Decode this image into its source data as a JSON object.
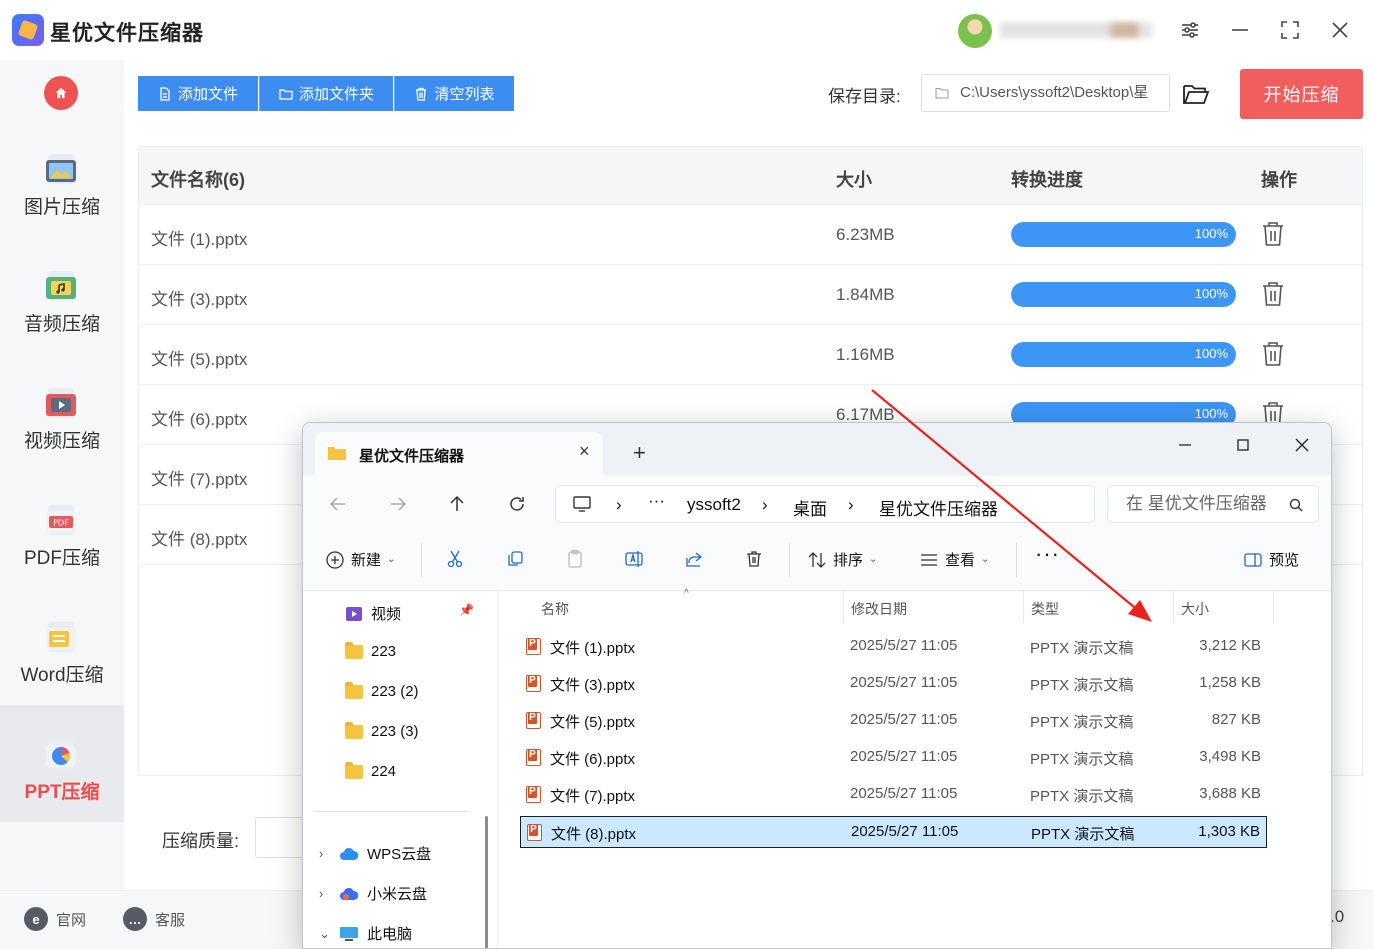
{
  "app": {
    "title": "星优文件压缩器",
    "user_name": "ysu4Fl3a1wd6"
  },
  "sidebar": {
    "items": [
      {
        "label": "图片压缩"
      },
      {
        "label": "音频压缩"
      },
      {
        "label": "视频压缩"
      },
      {
        "label": "PDF压缩"
      },
      {
        "label": "Word压缩"
      },
      {
        "label": "PPT压缩",
        "active": true
      }
    ]
  },
  "toolbar": {
    "add_file": "添加文件",
    "add_folder": "添加文件夹",
    "clear_list": "清空列表",
    "save_dir_label": "保存目录:",
    "save_dir_value": "C:\\Users\\yssoft2\\Desktop\\星",
    "start_button": "开始压缩"
  },
  "table": {
    "headers": {
      "name": "文件名称(6)",
      "size": "大小",
      "progress": "转换进度",
      "action": "操作"
    },
    "rows": [
      {
        "name": "文件 (1).pptx",
        "size": "6.23MB",
        "progress": 1.0,
        "progress_label": "100%"
      },
      {
        "name": "文件 (3).pptx",
        "size": "1.84MB",
        "progress": 1.0,
        "progress_label": "100%"
      },
      {
        "name": "文件 (5).pptx",
        "size": "1.16MB",
        "progress": 1.0,
        "progress_label": "100%"
      },
      {
        "name": "文件 (6).pptx",
        "size": "6.17MB",
        "progress": 1.0,
        "progress_label": "100%"
      },
      {
        "name": "文件 (7).pptx",
        "size": "",
        "progress": null,
        "progress_label": ""
      },
      {
        "name": "文件 (8).pptx",
        "size": "",
        "progress": null,
        "progress_label": ""
      }
    ]
  },
  "bottom": {
    "quality_label": "压缩质量:",
    "official_site": "官网",
    "support": "客服",
    "version_fragment": ".0"
  },
  "explorer": {
    "tab_title": "星优文件压缩器",
    "breadcrumb": [
      "yssoft2",
      "桌面",
      "星优文件压缩器"
    ],
    "search_placeholder": "在 星优文件压缩器",
    "commands": {
      "new": "新建",
      "sort": "排序",
      "view": "查看",
      "preview": "预览"
    },
    "nav_items": [
      {
        "label": "视频",
        "type": "video",
        "pinned": true
      },
      {
        "label": "223",
        "type": "folder"
      },
      {
        "label": "223 (2)",
        "type": "folder"
      },
      {
        "label": "223 (3)",
        "type": "folder"
      },
      {
        "label": "224",
        "type": "folder"
      }
    ],
    "nav_drives": [
      {
        "label": "WPS云盘",
        "expanded": false
      },
      {
        "label": "小米云盘",
        "expanded": false
      },
      {
        "label": "此电脑",
        "expanded": true
      }
    ],
    "columns": {
      "name": "名称",
      "modified": "修改日期",
      "type": "类型",
      "size": "大小"
    },
    "files": [
      {
        "name": "文件 (1).pptx",
        "modified": "2025/5/27 11:05",
        "type": "PPTX 演示文稿",
        "size": "3,212 KB"
      },
      {
        "name": "文件 (3).pptx",
        "modified": "2025/5/27 11:05",
        "type": "PPTX 演示文稿",
        "size": "1,258 KB"
      },
      {
        "name": "文件 (5).pptx",
        "modified": "2025/5/27 11:05",
        "type": "PPTX 演示文稿",
        "size": "827 KB"
      },
      {
        "name": "文件 (6).pptx",
        "modified": "2025/5/27 11:05",
        "type": "PPTX 演示文稿",
        "size": "3,498 KB"
      },
      {
        "name": "文件 (7).pptx",
        "modified": "2025/5/27 11:05",
        "type": "PPTX 演示文稿",
        "size": "3,688 KB"
      },
      {
        "name": "文件 (8).pptx",
        "modified": "2025/5/27 11:05",
        "type": "PPTX 演示文稿",
        "size": "1,303 KB",
        "selected": true
      }
    ]
  },
  "colors": {
    "accent_blue": "#3d8cf0",
    "start_red": "#f25e5e",
    "active_red": "#ef4b4b",
    "progress_blue": "#3d95f5",
    "annotation_arrow": "#e8231d"
  }
}
